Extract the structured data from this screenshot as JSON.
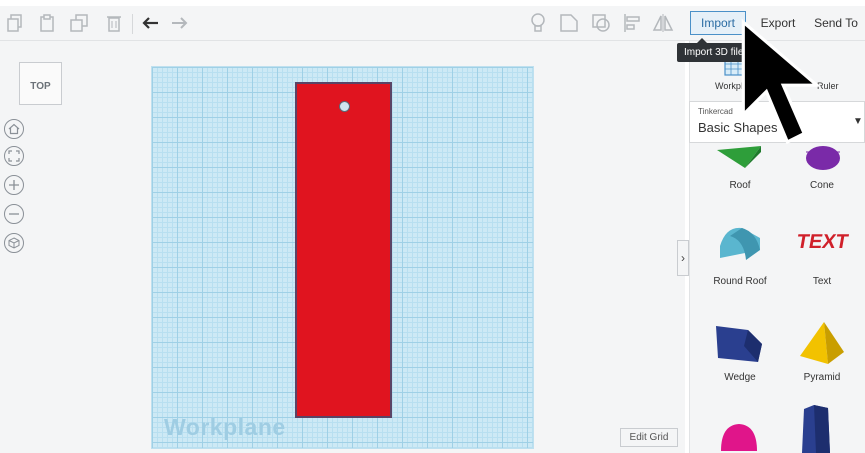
{
  "toolbar": {
    "icons": [
      "copy-icon",
      "paste-icon",
      "duplicate-icon",
      "delete-icon",
      "undo-icon",
      "redo-icon",
      "light-icon",
      "shape-icon",
      "group-icon",
      "align-icon",
      "mirror-icon"
    ]
  },
  "actions": {
    "import_label": "Import",
    "export_label": "Export",
    "send_to_label": "Send To"
  },
  "tooltip": {
    "text": "Import 3D file"
  },
  "view": {
    "viewcube_label": "TOP",
    "nav_icons": [
      "home-icon",
      "fit-icon",
      "zoom-in-icon",
      "zoom-out-icon",
      "perspective-icon"
    ]
  },
  "workplane": {
    "label": "Workplane",
    "edit_grid_label": "Edit Grid"
  },
  "panel": {
    "workplane_label": "Workplane",
    "ruler_label": "Ruler",
    "library_owner": "Tinkercad",
    "library_name": "Basic Shapes",
    "shapes": [
      {
        "name": "Roof",
        "color": "#2e9e3a"
      },
      {
        "name": "Cone",
        "color": "#7a2aa8"
      },
      {
        "name": "Round Roof",
        "color": "#5ab6cf"
      },
      {
        "name": "Text",
        "color": "#d0202a"
      },
      {
        "name": "Wedge",
        "color": "#2a3f8f"
      },
      {
        "name": "Pyramid",
        "color": "#f2c200"
      },
      {
        "name": "",
        "color": "#e0158a"
      },
      {
        "name": "",
        "color": "#2a3f8f"
      }
    ]
  },
  "colors": {
    "selected_shape": "#e0141f",
    "accent": "#4a90c8"
  }
}
